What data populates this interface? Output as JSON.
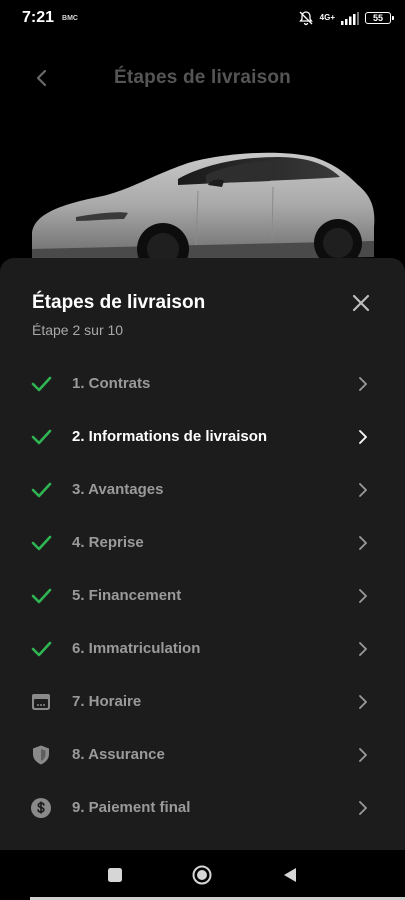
{
  "status_bar": {
    "time": "7:21",
    "note": "BMC",
    "network": "4G+",
    "battery": "55"
  },
  "background_header": {
    "title": "Étapes de livraison"
  },
  "sheet": {
    "title": "Étapes de livraison",
    "subtitle": "Étape 2 sur 10",
    "steps": [
      {
        "label": "1. Contrats",
        "status": "done",
        "icon": "check-icon"
      },
      {
        "label": "2. Informations de livraison",
        "status": "done",
        "icon": "check-icon",
        "active": true
      },
      {
        "label": "3. Avantages",
        "status": "done",
        "icon": "check-icon"
      },
      {
        "label": "4. Reprise",
        "status": "done",
        "icon": "check-icon"
      },
      {
        "label": "5. Financement",
        "status": "done",
        "icon": "check-icon"
      },
      {
        "label": "6. Immatriculation",
        "status": "done",
        "icon": "check-icon"
      },
      {
        "label": "7. Horaire",
        "status": "pending",
        "icon": "calendar-icon"
      },
      {
        "label": "8. Assurance",
        "status": "pending",
        "icon": "shield-icon"
      },
      {
        "label": "9. Paiement final",
        "status": "pending",
        "icon": "dollar-icon"
      }
    ]
  },
  "colors": {
    "check": "#2fb552",
    "sheet_bg": "#1c1c1c",
    "muted_text": "#9a9a9a"
  }
}
